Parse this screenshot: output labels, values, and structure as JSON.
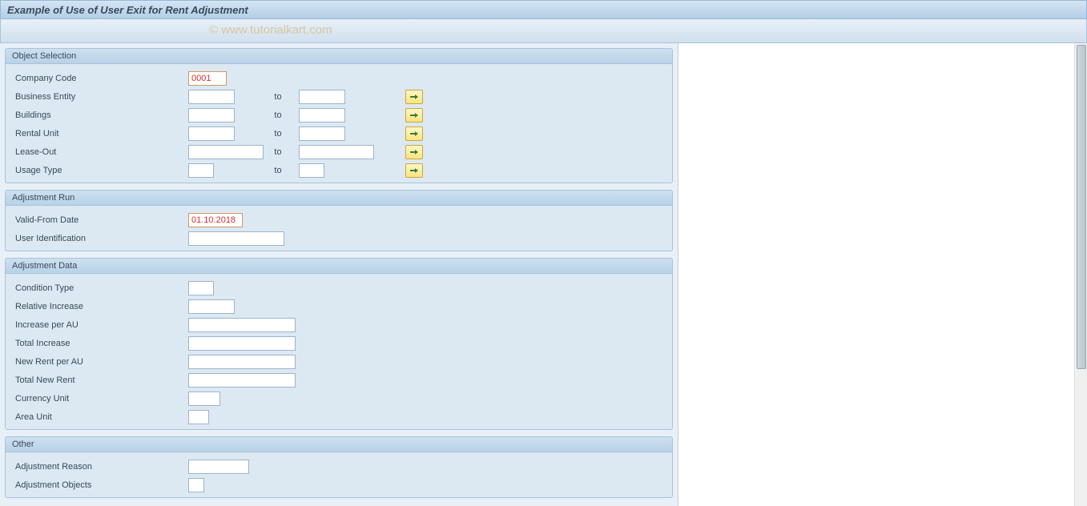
{
  "title": "Example of Use of User Exit for Rent Adjustment",
  "watermark": "© www.tutorialkart.com",
  "sections": {
    "objectSelection": {
      "title": "Object Selection",
      "companyCode": {
        "label": "Company Code",
        "value": "0001"
      },
      "businessEntity": {
        "label": "Business Entity",
        "from": "",
        "toLabel": "to",
        "to": ""
      },
      "buildings": {
        "label": "Buildings",
        "from": "",
        "toLabel": "to",
        "to": ""
      },
      "rentalUnit": {
        "label": "Rental Unit",
        "from": "",
        "toLabel": "to",
        "to": ""
      },
      "leaseOut": {
        "label": "Lease-Out",
        "from": "",
        "toLabel": "to",
        "to": ""
      },
      "usageType": {
        "label": "Usage Type",
        "from": "",
        "toLabel": "to",
        "to": ""
      }
    },
    "adjustmentRun": {
      "title": "Adjustment Run",
      "validFrom": {
        "label": "Valid-From Date",
        "value": "01.10.2018"
      },
      "userId": {
        "label": "User Identification",
        "value": ""
      }
    },
    "adjustmentData": {
      "title": "Adjustment Data",
      "conditionType": {
        "label": "Condition Type",
        "value": ""
      },
      "relativeIncrease": {
        "label": "Relative Increase",
        "value": ""
      },
      "increasePerAU": {
        "label": "Increase per AU",
        "value": ""
      },
      "totalIncrease": {
        "label": "Total Increase",
        "value": ""
      },
      "newRentPerAU": {
        "label": "New Rent per AU",
        "value": ""
      },
      "totalNewRent": {
        "label": "Total New Rent",
        "value": ""
      },
      "currencyUnit": {
        "label": "Currency Unit",
        "value": ""
      },
      "areaUnit": {
        "label": "Area Unit",
        "value": ""
      }
    },
    "other": {
      "title": "Other",
      "adjustmentReason": {
        "label": "Adjustment Reason",
        "value": ""
      },
      "adjustmentObjects": {
        "label": "Adjustment Objects",
        "value": ""
      }
    }
  }
}
